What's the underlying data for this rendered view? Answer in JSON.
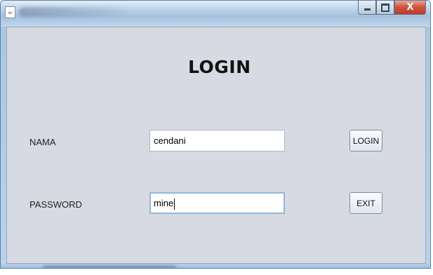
{
  "window": {
    "close_glyph": "X"
  },
  "form": {
    "heading": "LOGIN",
    "nama_label": "NAMA",
    "nama_value": "cendani",
    "password_label": "PASSWORD",
    "password_value": "mine",
    "login_button": "LOGIN",
    "exit_button": "EXIT"
  },
  "icons": {
    "app": "java-cup-icon",
    "minimize": "minimize-icon",
    "maximize": "maximize-icon",
    "close": "close-icon"
  },
  "colors": {
    "panel_bg": "#d7dae2",
    "close_button": "#c0392b",
    "field_focus_border": "#8fb8df"
  }
}
